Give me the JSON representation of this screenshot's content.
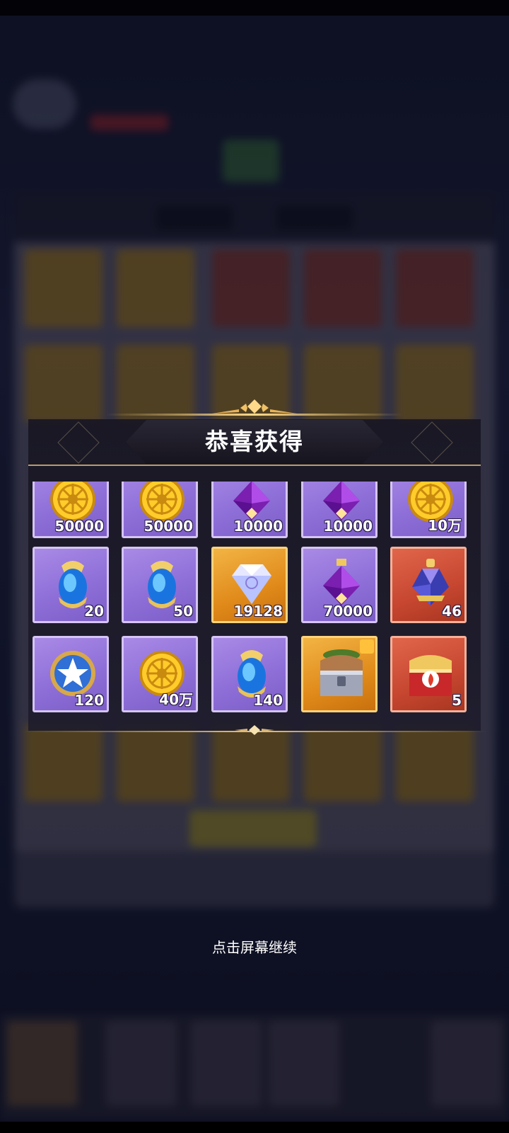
{
  "popup": {
    "title": "恭喜获得",
    "continue_hint": "点击屏幕继续"
  },
  "rewards": [
    {
      "item": "gold-coin",
      "quantity": "50000",
      "frame": "purple"
    },
    {
      "item": "gold-coin",
      "quantity": "50000",
      "frame": "purple"
    },
    {
      "item": "purple-potion",
      "quantity": "10000",
      "frame": "purple"
    },
    {
      "item": "purple-potion",
      "quantity": "10000",
      "frame": "purple"
    },
    {
      "item": "gold-coin",
      "quantity": "10万",
      "frame": "purple"
    },
    {
      "item": "blue-crystal-egg",
      "quantity": "20",
      "frame": "purple"
    },
    {
      "item": "blue-crystal-egg",
      "quantity": "50",
      "frame": "purple"
    },
    {
      "item": "diamond-gem",
      "quantity": "19128",
      "frame": "gold"
    },
    {
      "item": "purple-potion",
      "quantity": "70000",
      "frame": "purple"
    },
    {
      "item": "blue-elixir-bottle",
      "quantity": "46",
      "frame": "red"
    },
    {
      "item": "star-medal",
      "quantity": "120",
      "frame": "purple"
    },
    {
      "item": "gold-coin",
      "quantity": "40万",
      "frame": "purple"
    },
    {
      "item": "blue-crystal-egg",
      "quantity": "140",
      "frame": "purple"
    },
    {
      "item": "treasure-chest",
      "quantity": "",
      "frame": "gold"
    },
    {
      "item": "red-gift-chest",
      "quantity": "5",
      "frame": "red"
    }
  ],
  "colors": {
    "purple_frame": "#8e6fd8",
    "gold_frame": "#e08a1a",
    "red_frame": "#c64630",
    "accent_gold": "#ffd98a"
  }
}
